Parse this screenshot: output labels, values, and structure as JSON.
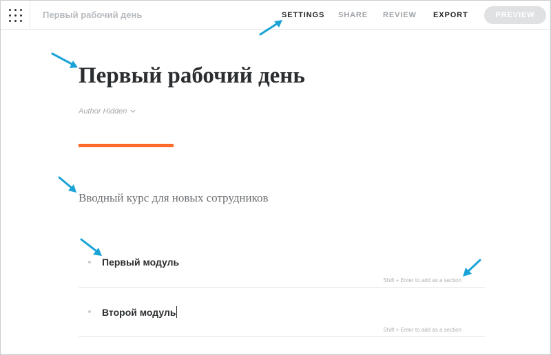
{
  "header": {
    "doc_title": "Первый рабочий день",
    "nav": {
      "settings": "SETTINGS",
      "share": "SHARE",
      "review": "REVIEW",
      "export": "EXPORT"
    },
    "preview_label": "PREVIEW"
  },
  "course": {
    "title": "Первый рабочий день",
    "author_label": "Author Hidden",
    "description": "Вводный курс для новых сотрудников"
  },
  "lessons": [
    {
      "title": "Первый модуль",
      "hint": "Shift + Enter to add as a section"
    },
    {
      "title": "Второй модуль",
      "hint": "Shift + Enter to add as a section"
    }
  ],
  "colors": {
    "accent": "#ff6a2b",
    "annotation_arrow": "#1aa3d6"
  },
  "icons": {
    "apps": "apps-grid-icon",
    "author_dropdown": "chevron-down-icon",
    "annotation": "arrow-icon"
  }
}
